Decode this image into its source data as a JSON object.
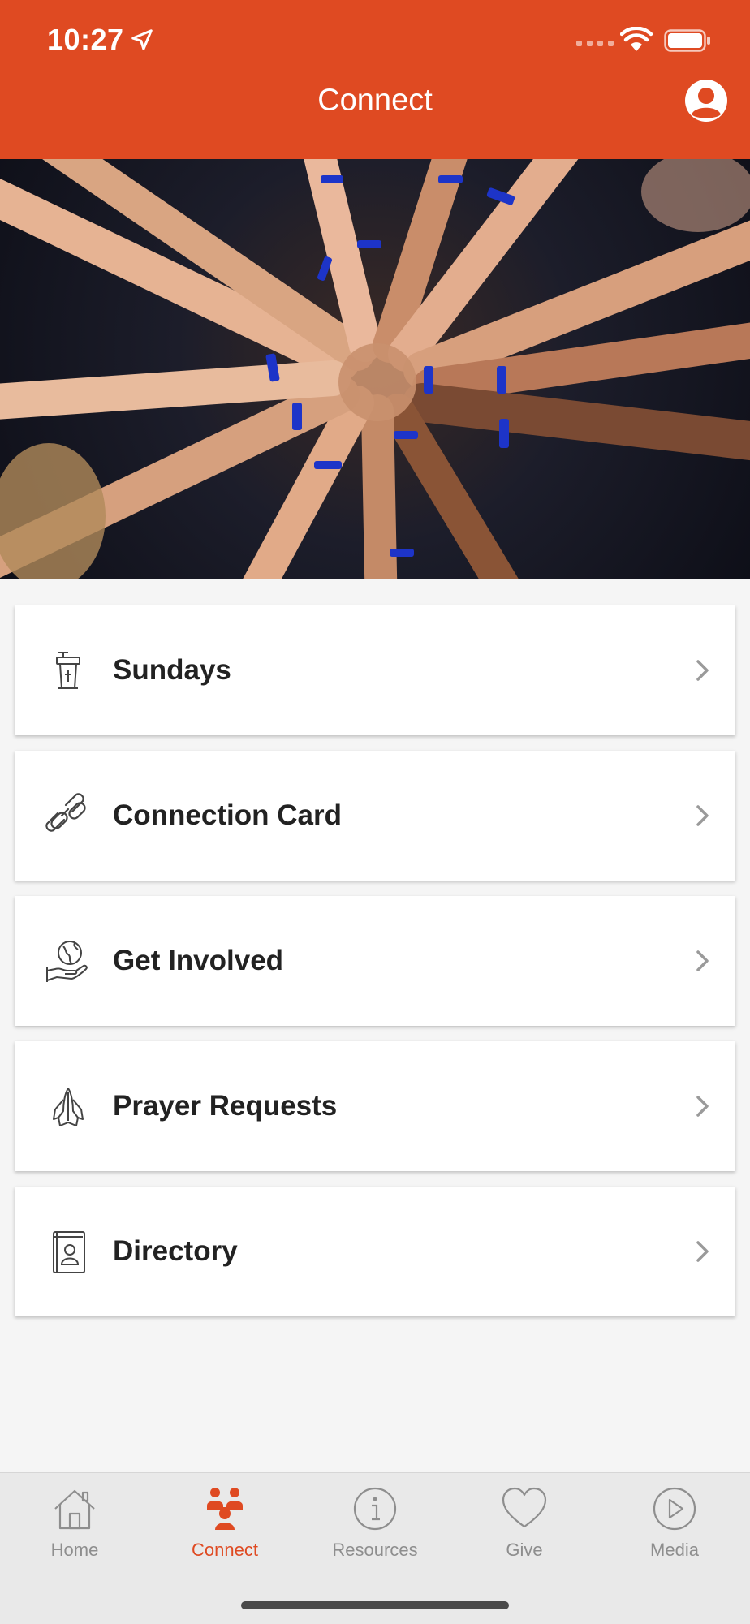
{
  "status_bar": {
    "time": "10:27"
  },
  "header": {
    "title": "Connect"
  },
  "hero": {
    "description": "Group of hands joined together in the center"
  },
  "menu": [
    {
      "label": "Sundays",
      "icon": "pulpit-icon"
    },
    {
      "label": "Connection Card",
      "icon": "link-icon"
    },
    {
      "label": "Get Involved",
      "icon": "globe-hand-icon"
    },
    {
      "label": "Prayer Requests",
      "icon": "praying-hands-icon"
    },
    {
      "label": "Directory",
      "icon": "contact-book-icon"
    }
  ],
  "tabs": [
    {
      "label": "Home",
      "icon": "home-icon",
      "active": false
    },
    {
      "label": "Connect",
      "icon": "people-icon",
      "active": true
    },
    {
      "label": "Resources",
      "icon": "info-icon",
      "active": false
    },
    {
      "label": "Give",
      "icon": "heart-icon",
      "active": false
    },
    {
      "label": "Media",
      "icon": "play-icon",
      "active": false
    }
  ],
  "colors": {
    "brand": "#df4a22",
    "tab_inactive": "#8e8e8e",
    "background": "#f5f5f5"
  }
}
